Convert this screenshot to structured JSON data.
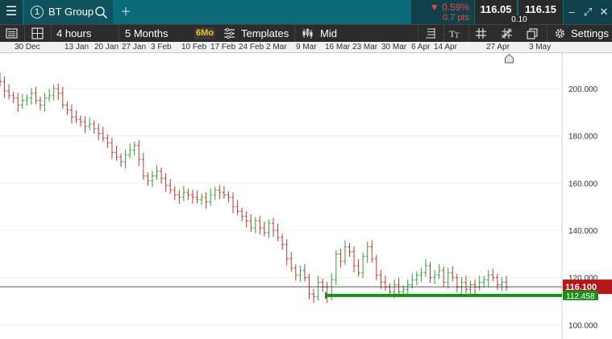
{
  "header": {
    "menu_icon": "hamburger-icon",
    "tab_number": "1",
    "instrument": "BT Group",
    "search_icon": "search-icon",
    "add_tab": "+",
    "change_pct": "▼ 0.59%",
    "change_pts": "0.7 pts",
    "sell": "116.05",
    "buy": "116.15",
    "spread": "0.10",
    "window_controls": [
      "–",
      "⤢",
      "✕"
    ]
  },
  "toolbar": {
    "timeframe": "4 hours",
    "range": "5 Months",
    "range_badge": "6Mo",
    "templates": "Templates",
    "price_type": "Mid",
    "settings": "Settings"
  },
  "date_axis": [
    "30 Dec",
    "13 Jan",
    "20 Jan",
    "27 Jan",
    "3 Feb",
    "10 Feb",
    "17 Feb",
    "24 Feb",
    "2 Mar",
    "9 Mar",
    "16 Mar",
    "23 Mar",
    "30 Mar",
    "6 Apr",
    "14 Apr",
    "27 Apr",
    "3 May"
  ],
  "chart_data": {
    "type": "ohlc",
    "instrument": "BT Group",
    "interval": "4 hours",
    "x_labels": [
      "30 Dec",
      "13 Jan",
      "20 Jan",
      "27 Jan",
      "3 Feb",
      "10 Feb",
      "17 Feb",
      "24 Feb",
      "2 Mar",
      "9 Mar",
      "16 Mar",
      "23 Mar",
      "30 Mar",
      "6 Apr",
      "14 Apr",
      "27 Apr",
      "3 May"
    ],
    "y_ticks": [
      "100.000",
      "120.000",
      "140.000",
      "160.000",
      "180.000",
      "200.000"
    ],
    "ylim": [
      94,
      215
    ],
    "closes": [
      203,
      199,
      197,
      196,
      193,
      195,
      196,
      198,
      195,
      193,
      196,
      197,
      200,
      198,
      193,
      191,
      188,
      187,
      186,
      184,
      185,
      183,
      181,
      179,
      177,
      173,
      171,
      169,
      172,
      174,
      176,
      170,
      163,
      161,
      163,
      165,
      162,
      159,
      157,
      155,
      154,
      156,
      155,
      154,
      153,
      154,
      152,
      155,
      157,
      156,
      155,
      154,
      150,
      148,
      146,
      144,
      141,
      144,
      141,
      139,
      143,
      140,
      137,
      134,
      128,
      124,
      121,
      123,
      120,
      113,
      112,
      118,
      116,
      112,
      119,
      130,
      127,
      133,
      131,
      125,
      122,
      129,
      133,
      128,
      121,
      118,
      116,
      114,
      117,
      114,
      115,
      117,
      119,
      121,
      122,
      125,
      120,
      121,
      123,
      118,
      122,
      120,
      116,
      118,
      115,
      117,
      116,
      118,
      119,
      121,
      120,
      117,
      118,
      116
    ],
    "current_price": "116.100",
    "current_price_value": 116.1,
    "support_level": "112.458",
    "support_value": 112.458,
    "colors": {
      "up": "#2fa12f",
      "down": "#c0392b",
      "support": "#1a8f1a",
      "price_tag": "#b3161b"
    }
  }
}
